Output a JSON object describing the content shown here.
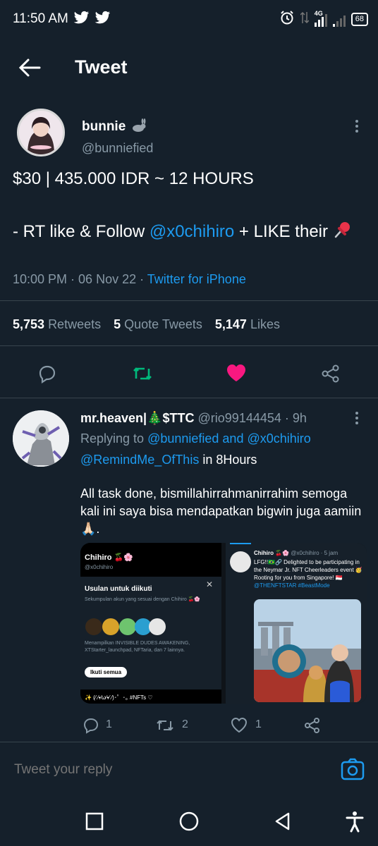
{
  "status_bar": {
    "time": "11:50 AM",
    "network": "4G",
    "battery": "68"
  },
  "header": {
    "title": "Tweet"
  },
  "tweet": {
    "name": "bunnie",
    "handle": "@bunniefied",
    "line1": "$30 | 435.000 IDR ~ 12 HOURS",
    "line2_prefix": "- RT like & Follow ",
    "line2_mention": "@x0chihiro",
    "line2_suffix": " + LIKE their",
    "time": "10:00 PM",
    "date": "06 Nov 22",
    "source": "Twitter for iPhone",
    "retweets_count": "5,753",
    "retweets_label": "Retweets",
    "quotes_count": "5",
    "quotes_label": "Quote Tweets",
    "likes_count": "5,147",
    "likes_label": "Likes"
  },
  "reply": {
    "name": "mr.heaven|🎄$TTC",
    "handle": "@rio99144454",
    "age": "9h",
    "replying_prefix": "Replying to",
    "replying_to": "@bunniefied and @x0chihiro",
    "remind_mention": "@RemindMe_OfThis",
    "remind_text": " in 8Hours",
    "body": "All task done, bismillahirrahmanirrahim semoga kali ini saya bisa mendapatkan bigwin juga aamiin 🙏🏻.",
    "reply_count": "1",
    "retweet_count": "2",
    "like_count": "1",
    "media": {
      "left_name": "Chihiro 🍒🌸",
      "left_handle": "@x0chihiro",
      "suggest_title": "Usulan untuk diikuti",
      "suggest_sub": "Sekumpulan akun yang sesuai dengan Chihiro 🍒🌸",
      "suggest_desc": "Menampilkan INVISIBLE DUDES AWAKENING, XTStarter_launchpad, NFTaria, dan 7 lainnya.",
      "follow_all": "Ikuti semua",
      "bio": "✨ (⁄ ⁄•⁄ω⁄•⁄ ⁄)･゜･｡ #NFTs ♡",
      "right_name": "Chihiro 🍒🌸",
      "right_handle": "@x0chihiro · 5 jam",
      "right_text": "LFG!!🇧🇷🔗 Delighted to be participating in the Neymar Jr. NFT Cheerleaders event 🥳 Rooting for you from Singapore! 🇸🇬",
      "right_mention": "@THENFTSTAR",
      "right_tag": "#BeastMode"
    }
  },
  "compose": {
    "placeholder": "Tweet your reply"
  },
  "colors": {
    "background": "#15202b",
    "accent": "#1d9bf0",
    "retweet": "#00ba7c",
    "like": "#f91880",
    "muted": "#8899a6"
  }
}
